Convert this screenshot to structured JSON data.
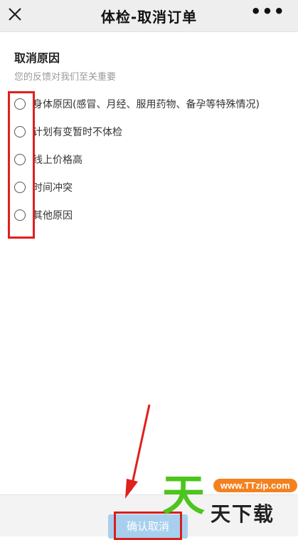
{
  "header": {
    "title": "体检-取消订单",
    "close_icon": "close-icon",
    "more_icon": "more-icon",
    "more_glyph": "•••"
  },
  "form": {
    "section_title": "取消原因",
    "section_subtitle": "您的反馈对我们至关重要",
    "options": [
      {
        "label": "身体原因(感冒、月经、服用药物、备孕等特殊情况)",
        "selected": false
      },
      {
        "label": "计划有变暂时不体检",
        "selected": false
      },
      {
        "label": "线上价格高",
        "selected": false
      },
      {
        "label": "时间冲突",
        "selected": false
      },
      {
        "label": "其他原因",
        "selected": false
      }
    ]
  },
  "footer": {
    "confirm_label": "确认取消"
  },
  "watermark": {
    "big_char": "天",
    "url": "www.TTzip.com",
    "text": "天下载"
  },
  "colors": {
    "annotation_red": "#e0201d",
    "button_bg": "#a8d0ee",
    "watermark_green": "#4cc51d",
    "watermark_orange": "#f4811f"
  }
}
